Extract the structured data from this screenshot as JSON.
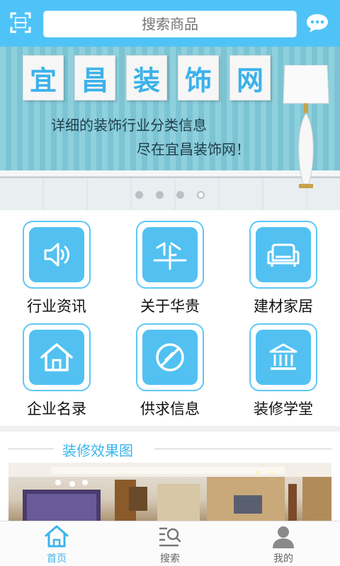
{
  "header": {
    "search_placeholder": "搜索商品",
    "accent_color": "#4fc3f7"
  },
  "banner": {
    "title_chars": [
      "宜",
      "昌",
      "装",
      "饰",
      "网"
    ],
    "slogan_line1": "详细的装饰行业分类信息",
    "slogan_line2": "尽在宜昌装饰网！",
    "slide_count": 4,
    "active_slide": 4
  },
  "grid": {
    "items": [
      {
        "label": "行业资讯",
        "icon": "speaker-icon"
      },
      {
        "label": "关于华贵",
        "icon": "hua-logo-icon"
      },
      {
        "label": "建材家居",
        "icon": "sofa-icon"
      },
      {
        "label": "企业名录",
        "icon": "house-icon"
      },
      {
        "label": "供求信息",
        "icon": "compass-icon"
      },
      {
        "label": "装修学堂",
        "icon": "bank-icon"
      }
    ]
  },
  "section": {
    "title": "装修效果图"
  },
  "bottom_nav": {
    "items": [
      {
        "label": "首页",
        "icon": "home-icon",
        "active": true
      },
      {
        "label": "搜索",
        "icon": "search-list-icon",
        "active": false
      },
      {
        "label": "我的",
        "icon": "user-icon",
        "active": false
      }
    ]
  }
}
